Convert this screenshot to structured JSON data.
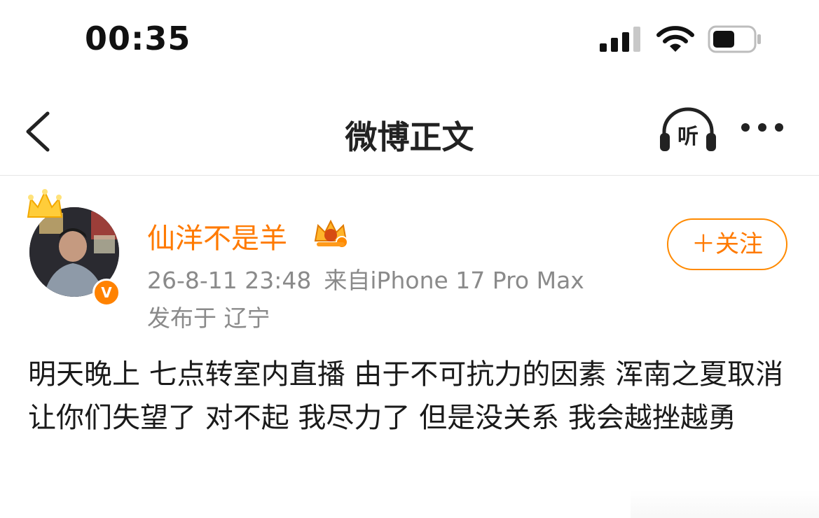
{
  "status_bar": {
    "time": "00:35"
  },
  "nav": {
    "title": "微博正文",
    "listen_label": "听"
  },
  "post": {
    "author": "仙洋不是羊",
    "timestamp": "26-8-11 23:48",
    "source": "来自iPhone 17 Pro Max",
    "location": "发布于 辽宁",
    "follow_label": "＋关注",
    "verified_badge": "V",
    "text": "明天晚上 七点转室内直播 由于不可抗力的因素 浑南之夏取消 让你们失望了 对不起 我尽力了 但是没关系 我会越挫越勇"
  },
  "colors": {
    "accent": "#ff7a00",
    "meta_gray": "#8a8a8a"
  },
  "icons": [
    "back-icon",
    "headphone-icon",
    "more-icon",
    "crown-icon",
    "vip-crown-icon",
    "signal-icon",
    "wifi-icon",
    "battery-icon"
  ]
}
